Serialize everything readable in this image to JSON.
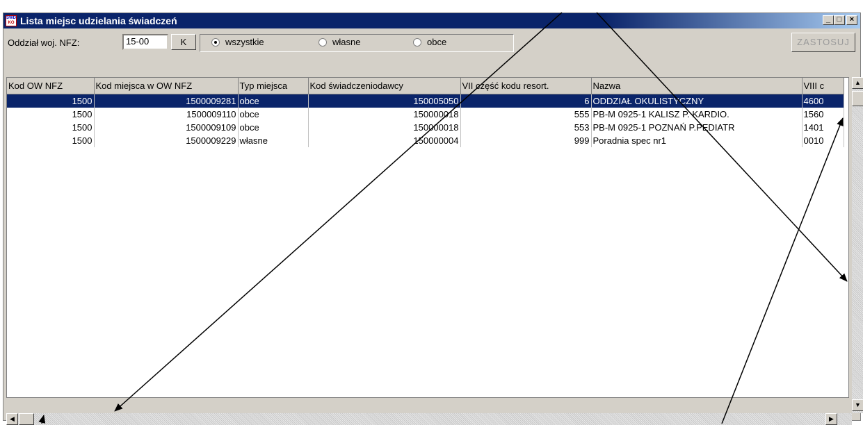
{
  "window": {
    "title": "Lista miejsc udzielania świadczeń",
    "icon_top": "SWD",
    "icon_bottom": "KO",
    "minimize": "_",
    "maximize": "□",
    "close": "×"
  },
  "toolbar": {
    "oddzial_label": "Oddział woj. NFZ:",
    "oddzial_value": "15-00",
    "k_button": "K",
    "radio_all": "wszystkie",
    "radio_own": "własne",
    "radio_foreign": "obce",
    "selected_radio": "wszystkie",
    "apply_button": "ZASTOSUJ"
  },
  "grid": {
    "columns": [
      "Kod OW NFZ",
      "Kod miejsca w OW NFZ",
      "Typ miejsca",
      "Kod świadczeniodawcy",
      "VII część kodu resort.",
      "Nazwa",
      "VIII c"
    ],
    "rows": [
      [
        "1500",
        "1500009281",
        "obce",
        "150005050",
        "6",
        "ODDZIAŁ OKULISTYCZNY",
        "4600"
      ],
      [
        "1500",
        "1500009110",
        "obce",
        "150000018",
        "555",
        "PB-M 0925-1 KALISZ P. KARDIO.",
        "1560"
      ],
      [
        "1500",
        "1500009109",
        "obce",
        "150000018",
        "553",
        "PB-M 0925-1 POZNAŃ P.PEDIATR",
        "1401"
      ],
      [
        "1500",
        "1500009229",
        "własne",
        "150000004",
        "999",
        "Poradnia spec nr1",
        "0010"
      ]
    ],
    "selected_row": 0
  },
  "scroll": {
    "up": "▲",
    "down": "▼",
    "left": "◀",
    "right": "▶"
  },
  "colors": {
    "selection": "#0a246a",
    "title_bar": "#0a246a",
    "window_face": "#d4d0c8"
  }
}
